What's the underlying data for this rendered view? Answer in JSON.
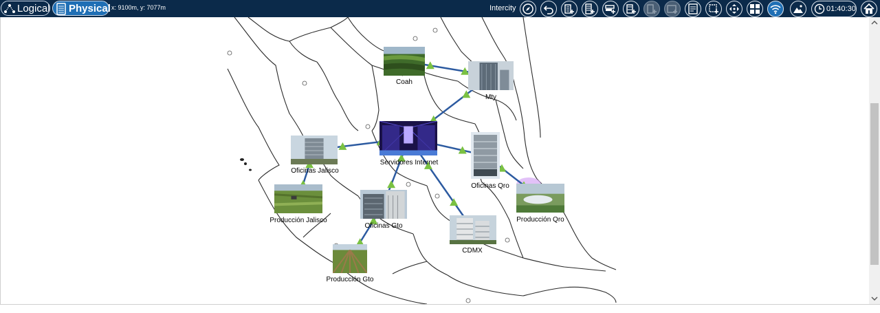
{
  "header": {
    "logical_label": "Logical",
    "physical_label": "Physical",
    "coords": "x: 9100m, y: 7077m",
    "context": "Intercity",
    "clock": "01:40:30"
  },
  "colors": {
    "bar_bg": "#0b2a4a",
    "active_button": "#1f6fb5",
    "link_line": "#2c5aa0",
    "triangle": "#7ac142"
  },
  "toolbar_icons": [
    "compass-icon",
    "undo-icon",
    "add-building-icon",
    "add-rack-icon",
    "add-device-icon",
    "add-server-icon",
    "add-disabled-icon",
    "add-panel-icon",
    "report-icon",
    "group-icon",
    "move-icon",
    "grid-layout-icon",
    "wifi-icon",
    "landscape-icon",
    "clock-icon",
    "home-icon"
  ],
  "nodes": [
    {
      "id": "coah",
      "label": "Coah",
      "kind": "farm"
    },
    {
      "id": "mty",
      "label": "Mty",
      "kind": "tower"
    },
    {
      "id": "servidores",
      "label": "Servidores Internet",
      "kind": "datacenter"
    },
    {
      "id": "oficinas-jalisco",
      "label": "Oficinas Jalisco",
      "kind": "office"
    },
    {
      "id": "oficinas-qro",
      "label": "Oficinas Qro",
      "kind": "office-tall"
    },
    {
      "id": "produccion-jalisco",
      "label": "Producción Jalisco",
      "kind": "field"
    },
    {
      "id": "oficinas-gto",
      "label": "Oficinas Gto",
      "kind": "modern"
    },
    {
      "id": "produccion-qro",
      "label": "Producción Qro",
      "kind": "dome"
    },
    {
      "id": "cdmx",
      "label": "CDMX",
      "kind": "apartments"
    },
    {
      "id": "produccion-gto",
      "label": "Producción Gto",
      "kind": "rows"
    }
  ],
  "links": [
    [
      "coah",
      "mty"
    ],
    [
      "mty",
      "servidores"
    ],
    [
      "servidores",
      "oficinas-jalisco"
    ],
    [
      "servidores",
      "oficinas-qro"
    ],
    [
      "oficinas-qro",
      "produccion-qro"
    ],
    [
      "servidores",
      "cdmx"
    ],
    [
      "servidores",
      "oficinas-gto"
    ],
    [
      "oficinas-jalisco",
      "produccion-jalisco"
    ],
    [
      "oficinas-gto",
      "produccion-gto"
    ]
  ]
}
